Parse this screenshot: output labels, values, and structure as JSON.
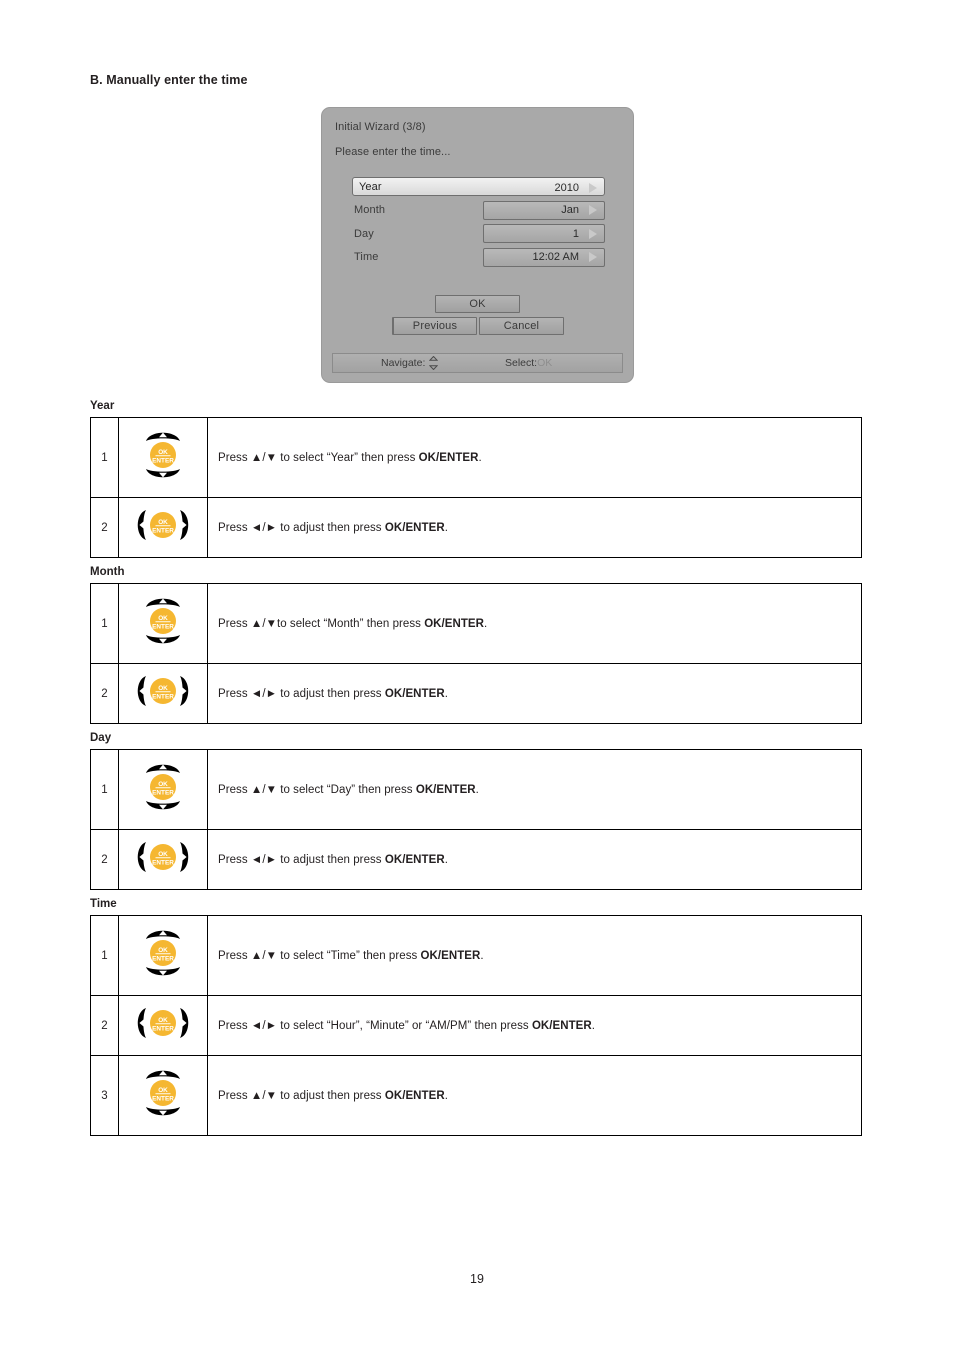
{
  "page": {
    "heading": "B. Manually enter the time",
    "number": "19"
  },
  "osd": {
    "title": "Initial Wizard (3/8)",
    "subtitle": "Please enter the time...",
    "fields": [
      {
        "label": "Year",
        "value": "2010",
        "selected": true
      },
      {
        "label": "Month",
        "value": "Jan",
        "selected": false
      },
      {
        "label": "Day",
        "value": "1",
        "selected": false
      },
      {
        "label": "Time",
        "value": "12:02 AM",
        "selected": false
      }
    ],
    "buttons": {
      "ok": "OK",
      "previous": "Previous",
      "cancel": "Cancel"
    },
    "footer": {
      "navigate_label": "Navigate:",
      "select_label": "Select:",
      "select_value": "OK"
    }
  },
  "sections": [
    {
      "title": "Year",
      "rows": [
        {
          "num": "1",
          "icon": "dpad-up-down-ok-icon",
          "text_pre": "Press ▲/▼ to select “Year” then press ",
          "text_bold": "OK/ENTER",
          "text_post": "."
        },
        {
          "num": "2",
          "icon": "dpad-left-right-ok-icon",
          "text_pre": "Press ◄/► to adjust then press ",
          "text_bold": "OK/ENTER",
          "text_post": "."
        }
      ]
    },
    {
      "title": "Month",
      "rows": [
        {
          "num": "1",
          "icon": "dpad-up-down-ok-icon",
          "text_pre": "Press ▲/▼to select “Month” then press ",
          "text_bold": "OK/ENTER",
          "text_post": "."
        },
        {
          "num": "2",
          "icon": "dpad-left-right-ok-icon",
          "text_pre": "Press ◄/► to adjust then press ",
          "text_bold": "OK/ENTER",
          "text_post": "."
        }
      ]
    },
    {
      "title": "Day",
      "rows": [
        {
          "num": "1",
          "icon": "dpad-up-down-ok-icon",
          "text_pre": "Press ▲/▼ to select “Day” then press ",
          "text_bold": "OK/ENTER",
          "text_post": "."
        },
        {
          "num": "2",
          "icon": "dpad-left-right-ok-icon",
          "text_pre": "Press ◄/► to adjust then press ",
          "text_bold": "OK/ENTER",
          "text_post": "."
        }
      ]
    },
    {
      "title": "Time",
      "rows": [
        {
          "num": "1",
          "icon": "dpad-up-down-ok-icon",
          "text_pre": "Press ▲/▼ to select “Time” then press ",
          "text_bold": "OK/ENTER",
          "text_post": "."
        },
        {
          "num": "2",
          "icon": "dpad-left-right-ok-icon",
          "text_pre": "Press ◄/► to select “Hour”, “Minute” or “AM/PM” then press ",
          "text_bold": "OK/ENTER",
          "text_post": "."
        },
        {
          "num": "3",
          "icon": "dpad-up-down-ok-icon",
          "text_pre": "Press ▲/▼ to adjust then press ",
          "text_bold": "OK/ENTER",
          "text_post": "."
        }
      ]
    }
  ],
  "icon_labels": {
    "ok_line1": "OK",
    "ok_line2": "ENTER"
  },
  "colors": {
    "ok_button": "#F5B731",
    "dpad": "#000000",
    "osd_bg": "#A9A9A9"
  }
}
